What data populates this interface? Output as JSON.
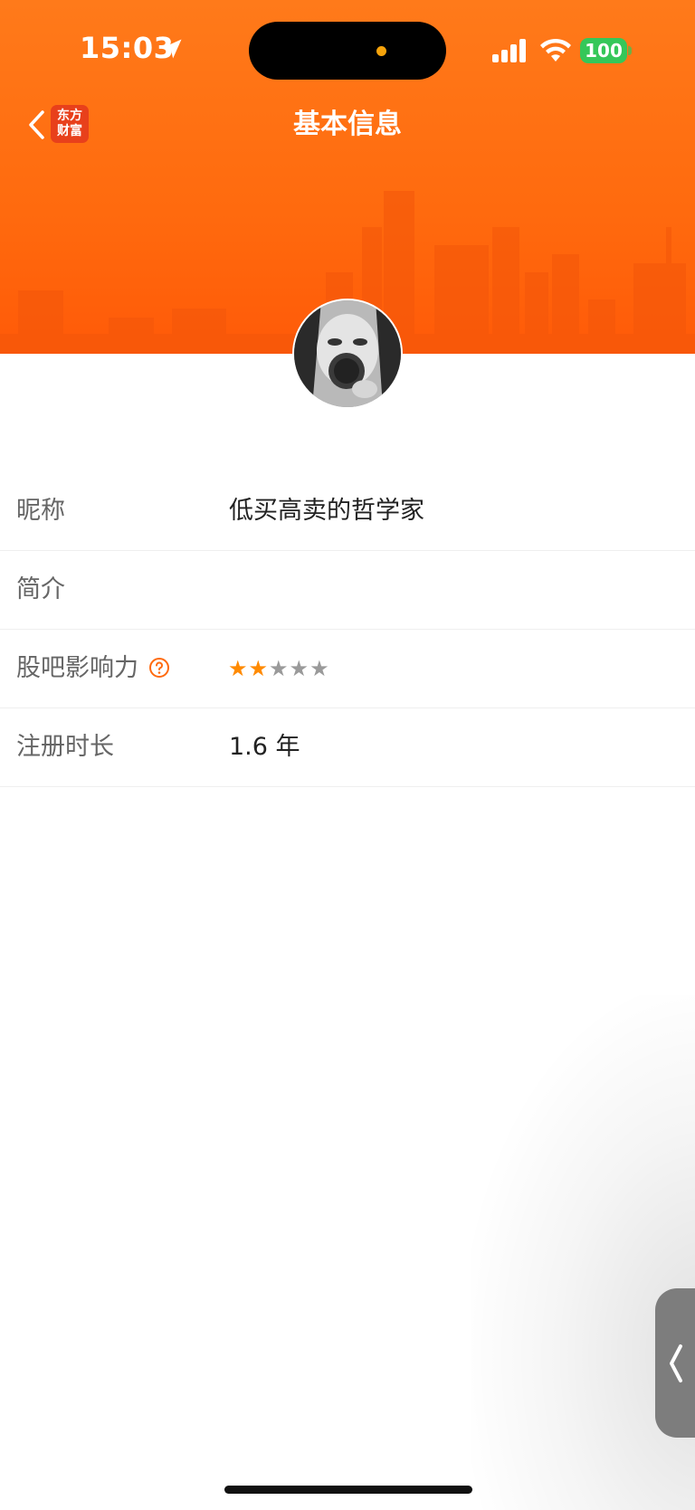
{
  "status_bar": {
    "time": "15:03",
    "battery": "100",
    "icons": [
      "location-arrow-icon",
      "cellular-signal-icon",
      "wifi-icon",
      "battery-icon"
    ]
  },
  "nav": {
    "title": "基本信息",
    "back_icon": "chevron-left-icon",
    "logo_line1": "东方",
    "logo_line2": "财富"
  },
  "profile": {
    "avatar": "user-avatar-photo"
  },
  "info_rows": [
    {
      "label": "昵称",
      "value": "低买高卖的哲学家"
    },
    {
      "label": "简介",
      "value": ""
    },
    {
      "label": "股吧影响力",
      "value": "",
      "rating": 2,
      "rating_max": 5,
      "help_icon": "question-circle-icon"
    },
    {
      "label": "注册时长",
      "value": "1.6 年"
    }
  ],
  "star_on": "★★",
  "star_off": "★★★",
  "colors": {
    "header": "#ff6a0e",
    "accent": "#ff8a00",
    "logo": "#e8401b",
    "battery": "#35c759"
  },
  "side_tab_icon": "chevron-left-icon"
}
